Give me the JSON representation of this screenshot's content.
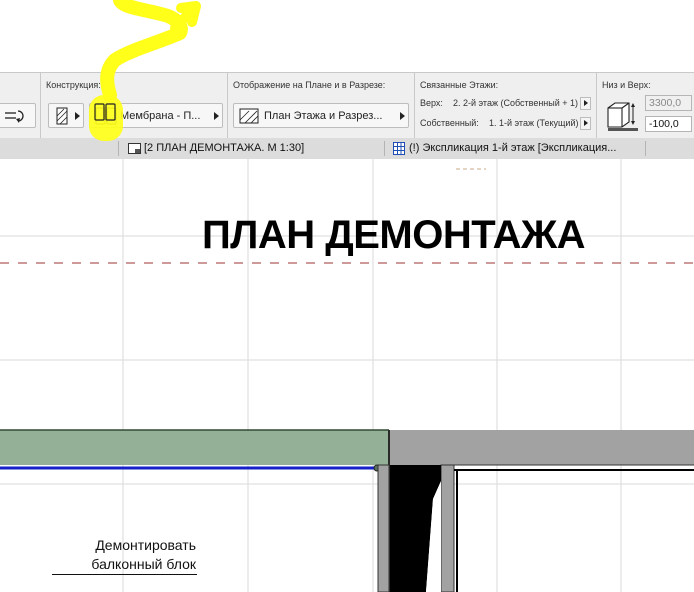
{
  "infobox": {
    "construction": {
      "label": "Конструкция:",
      "profile_button": "Мембрана - П..."
    },
    "display": {
      "label": "Отображение на Плане и в Разрезе:",
      "button": "План Этажа и Разрез..."
    },
    "stories": {
      "label": "Связанные Этажи:",
      "top_label": "Верх:",
      "top_value": "2. 2-й этаж (Собственный + 1)",
      "home_label": "Собственный:",
      "home_value": "1. 1-й этаж (Текущий)"
    },
    "bottom_top": {
      "label": "Низ и Верх:",
      "top_value": "3300,0",
      "bottom_value": "-100,0"
    }
  },
  "tabs": [
    {
      "label": "[2 ПЛАН ДЕМОНТАЖА. М 1:30]",
      "icon": "layout-icon"
    },
    {
      "label": "(!) Экспликация 1-й этаж [Экспликация...",
      "icon": "schedule-icon"
    }
  ],
  "drawing": {
    "title": "ПЛАН ДЕМОНТАЖА",
    "note_line1": "Демонтировать",
    "note_line2": "балконный блок"
  },
  "colors": {
    "annotation": "#ffff1a",
    "wall_fill": "#94b097",
    "wall_line": "#1420c8",
    "section_line": "#9b3333",
    "grid": "#dadada"
  }
}
